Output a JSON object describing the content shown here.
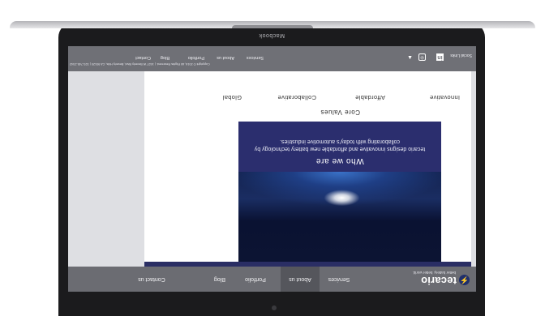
{
  "device": {
    "label": "Macbook"
  },
  "site": {
    "name": "tecario",
    "tagline": "better battery. better world."
  },
  "nav": {
    "items": [
      {
        "label": "Services",
        "active": false
      },
      {
        "label": "About us",
        "active": true
      },
      {
        "label": "Portfolio",
        "active": false
      },
      {
        "label": "Blog",
        "active": false
      },
      {
        "label": "Contact us",
        "active": false
      }
    ]
  },
  "hero": {
    "title": "Who we are",
    "text": "tecario designs innovative and affordable new battery technology by collaborating with today's automotive industries."
  },
  "core_values": {
    "title": "Core Values",
    "items": [
      "Innovative",
      "Affordable",
      "Collaborative",
      "Global"
    ]
  },
  "footer": {
    "social_label": "Social Links",
    "social_icons": [
      "linkedin-icon",
      "instagram-icon",
      "twitter-icon"
    ],
    "copyright": "Copyright © 2016, All Rights Reserved. | 1627 W Beverly Blvd, Beverly Hills, CA 90120 | 323-745-2342",
    "links": [
      "Services",
      "About us",
      "Portfolio",
      "Blog",
      "Contact"
    ]
  },
  "colors": {
    "nav_bg": "#6b6c72",
    "hero_panel": "#2b2e6e",
    "bezel": "#1b1b1d"
  }
}
